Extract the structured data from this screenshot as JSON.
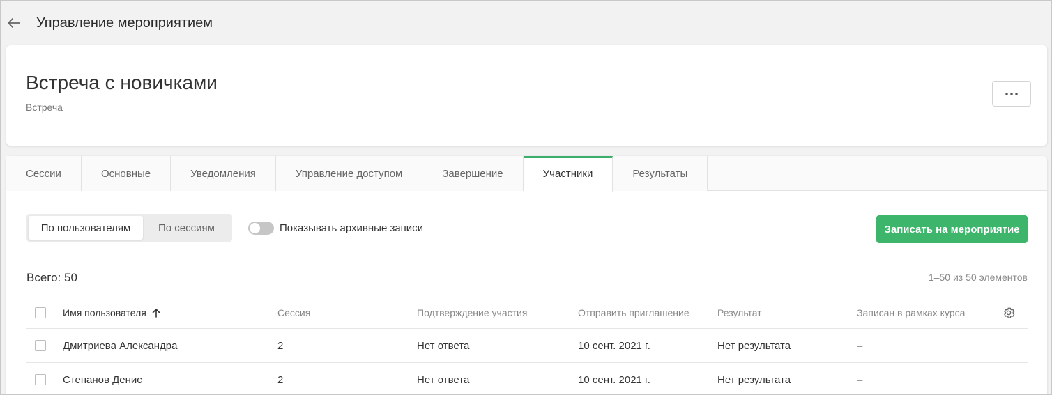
{
  "header": {
    "title": "Управление мероприятием"
  },
  "event": {
    "title": "Встреча с новичками",
    "type": "Встреча"
  },
  "tabs": [
    {
      "label": "Сессии"
    },
    {
      "label": "Основные"
    },
    {
      "label": "Уведомления"
    },
    {
      "label": "Управление доступом"
    },
    {
      "label": "Завершение"
    },
    {
      "label": "Участники",
      "active": true
    },
    {
      "label": "Результаты"
    }
  ],
  "view_switch": {
    "by_users": "По пользователям",
    "by_sessions": "По сессиям"
  },
  "archive_toggle": {
    "label": "Показывать архивные записи",
    "on": false
  },
  "enroll_button": "Записать на мероприятие",
  "total": "Всего: 50",
  "pagination": "1–50 из 50 элементов",
  "table": {
    "columns": [
      "Имя пользователя",
      "Сессия",
      "Подтверждение участия",
      "Отправить приглашение",
      "Результат",
      "Записан в рамках курса"
    ],
    "rows": [
      [
        "Дмитриева Александра",
        "2",
        "Нет ответа",
        "10 сент. 2021 г.",
        "Нет результата",
        "–"
      ],
      [
        "Степанов Денис",
        "2",
        "Нет ответа",
        "10 сент. 2021 г.",
        "Нет результата",
        "–"
      ]
    ]
  },
  "colors": {
    "accent": "#3db56b",
    "tab_active_border": "#3dae6b",
    "background": "#f2f2f2"
  }
}
